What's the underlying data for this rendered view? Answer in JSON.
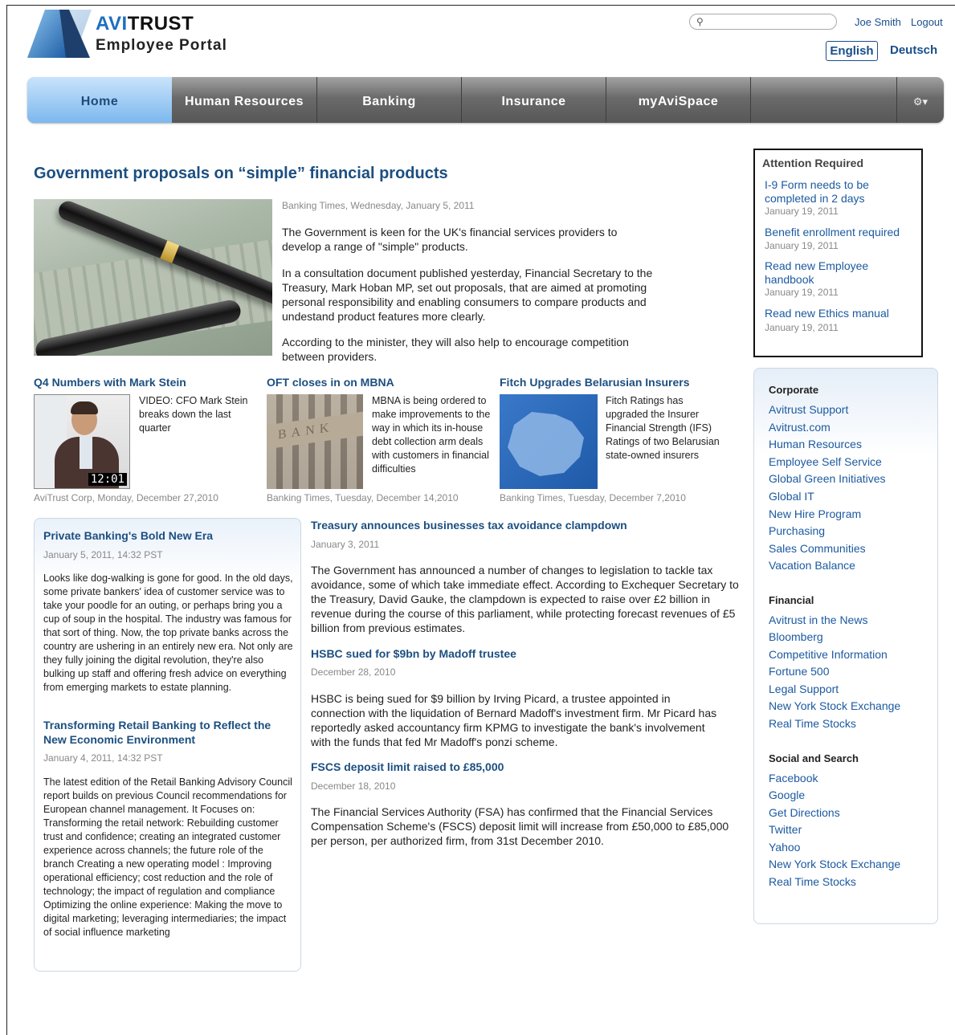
{
  "header": {
    "brand_prefix": "AVI",
    "brand_suffix": "TRUST",
    "portal": "Employee Portal",
    "search_placeholder": "",
    "user": "Joe Smith",
    "logout": "Logout",
    "lang_en": "English",
    "lang_de": "Deutsch"
  },
  "nav": {
    "tabs": [
      "Home",
      "Human Resources",
      "Banking",
      "Insurance",
      "myAviSpace"
    ],
    "active": "Home",
    "settings_icon": "gear-icon"
  },
  "main_article": {
    "title": "Government proposals on “simple” financial products",
    "meta": "Banking Times, Wednesday, January 5, 2011",
    "p1": "The Government is keen for the UK's financial services providers to develop a range of \"simple\" products.",
    "p2": "In a consultation document published yesterday, Financial Secretary to the Treasury, Mark Hoban MP, set out proposals, that are aimed at promoting personal responsibility and enabling consumers to compare products and undestand product features more clearly.",
    "p3": "According to the minister, they will also help to encourage competition between providers."
  },
  "features": [
    {
      "title": "Q4 Numbers with Mark Stein",
      "text": "VIDEO: CFO Mark Stein breaks down the last quarter",
      "duration": "12:01",
      "meta": "AviTrust Corp, Monday, December 27,2010"
    },
    {
      "title": "OFT closes in on MBNA",
      "text": "MBNA is being ordered to make improvements to the way in which its in-house debt collection arm deals with customers in financial difficulties",
      "sign": "BANK",
      "meta": "Banking Times, Tuesday, December 14,2010"
    },
    {
      "title": "Fitch Upgrades Belarusian Insurers",
      "text": "Fitch Ratings has upgraded the Insurer Financial Strength (IFS) Ratings of two Belarusian state-owned insurers",
      "meta": "Banking Times, Tuesday, December 7,2010"
    }
  ],
  "private_banking": [
    {
      "title": "Private Banking's Bold New Era",
      "meta": "January 5, 2011, 14:32 PST",
      "text": "Looks like dog-walking is gone for good. In the old days, some private bankers' idea of customer service was to take your poodle for an outing, or perhaps bring you a cup of soup in the hospital. The industry was famous for that sort of thing. Now, the top private banks across the country are ushering in an entirely new era. Not only are they fully joining the digital revolution, they're also bulking up staff and offering fresh advice on everything from emerging markets to estate planning."
    },
    {
      "title": "Transforming Retail Banking to Reflect the New Economic Environment",
      "meta": "January 4, 2011, 14:32 PST",
      "text": "The latest edition of the Retail Banking Advisory Council report builds on previous Council recommendations for European channel management. It Focuses on: Transforming the retail network: Rebuilding customer trust and confidence; creating an integrated customer experience across channels; the future role of the branch Creating a new operating model : Improving operational efficiency; cost reduction and the role of technology; the impact of regulation and compliance Optimizing the online experience: Making the move to digital marketing; leveraging intermediaries; the impact of social influence marketing"
    }
  ],
  "news": [
    {
      "title": "Treasury announces businesses tax avoidance clampdown",
      "meta": "January 3, 2011",
      "text": "The Government has announced a number of changes to legislation to tackle tax avoidance, some of which take immediate effect. According to Exchequer Secretary to the Treasury, David Gauke, the clampdown is expected to raise over £2 billion in revenue during the course of this parliament, while protecting forecast revenues of £5 billion from previous estimates."
    },
    {
      "title": "HSBC sued for $9bn by Madoff trustee",
      "meta": "December 28, 2010",
      "text": "HSBC is being sued for $9 billion by Irving Picard, a trustee appointed in connection with the liquidation of Bernard Madoff's investment firm. Mr Picard has reportedly asked accountancy firm KPMG to investigate the bank's involvement with the funds that fed Mr Madoff's ponzi scheme."
    },
    {
      "title": "FSCS deposit limit raised to £85,000",
      "meta": "December 18, 2010",
      "text": "The Financial Services Authority (FSA) has confirmed that the Financial Services Compensation Scheme's (FSCS) deposit limit will increase from £50,000 to £85,000 per person, per authorized firm, from 31st December 2010."
    }
  ],
  "attention": {
    "title": "Attention Required",
    "items": [
      {
        "text": "I-9 Form needs to be completed in 2 days",
        "date": "January 19, 2011"
      },
      {
        "text": "Benefit enrollment required",
        "date": "January 19, 2011"
      },
      {
        "text": "Read new Employee handbook",
        "date": "January 19, 2011"
      },
      {
        "text": "Read new Ethics manual",
        "date": "January 19, 2011"
      }
    ]
  },
  "links": {
    "corporate": {
      "title": "Corporate",
      "items": [
        "Avitrust Support",
        "Avitrust.com",
        "Human Resources",
        "Employee Self Service",
        "Global Green Initiatives",
        "Global IT",
        "New Hire Program",
        "Purchasing",
        "Sales Communities",
        "Vacation Balance"
      ]
    },
    "financial": {
      "title": "Financial",
      "items": [
        "Avitrust in the News",
        "Bloomberg",
        "Competitive Information",
        "Fortune 500",
        "Legal Support",
        "New York Stock Exchange",
        "Real Time Stocks"
      ]
    },
    "social": {
      "title": "Social and Search",
      "items": [
        "Facebook",
        "Google",
        "Get Directions",
        "Twitter",
        "Yahoo",
        "New York Stock Exchange",
        "Real Time Stocks"
      ]
    }
  },
  "colors": {
    "accent": "#1c4f80",
    "link": "#1c5aa0",
    "nav_active": "#7cb8ee"
  }
}
